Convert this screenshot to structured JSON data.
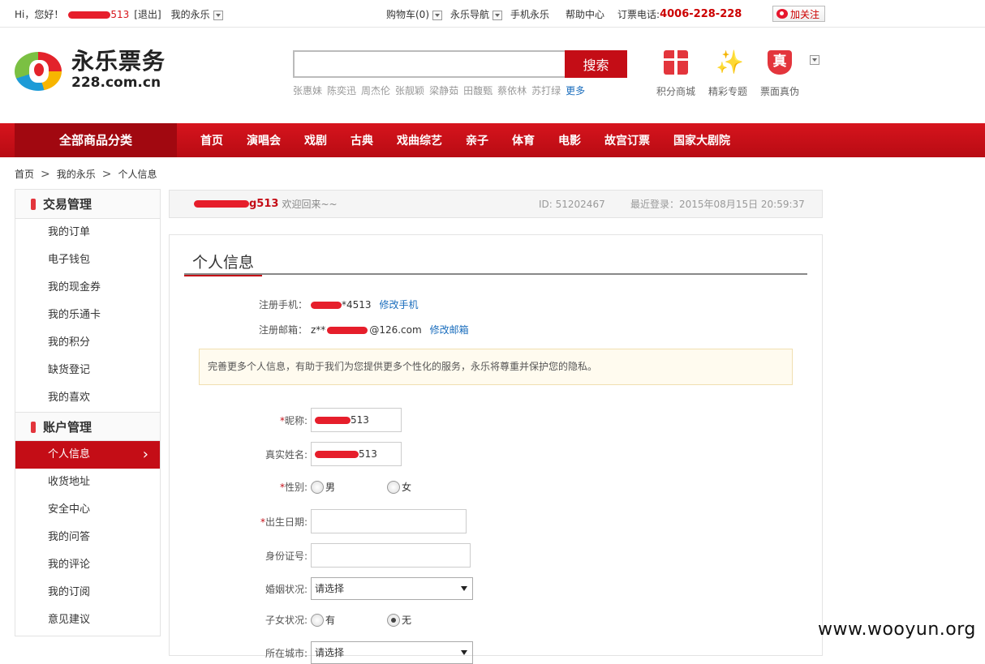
{
  "topbar": {
    "greeting": "Hi，您好！",
    "username_tail": "513",
    "logout": "[退出]",
    "my_yongle": "我的永乐",
    "cart": "购物车(0)",
    "nav_guide": "永乐导航",
    "mobile": "手机永乐",
    "help": "帮助中心",
    "phone_label": "订票电话:",
    "phone": "4006-228-228",
    "follow": "加关注"
  },
  "header": {
    "logo_cn": "永乐票务",
    "logo_en": "228.com.cn",
    "search_button": "搜索",
    "search_placeholder": "",
    "hot_keywords": [
      "张惠妹",
      "陈奕迅",
      "周杰伦",
      "张靓颖",
      "梁静茹",
      "田馥甄",
      "蔡依林",
      "苏打绿"
    ],
    "hot_more": "更多",
    "icons": [
      {
        "label": "积分商城",
        "icon": "gift-icon"
      },
      {
        "label": "精彩专题",
        "icon": "sparkle-wand-icon"
      },
      {
        "label": "票面真伪",
        "icon": "shield-true-icon",
        "glyph": "真"
      }
    ]
  },
  "nav": {
    "all_categories": "全部商品分类",
    "items": [
      "首页",
      "演唱会",
      "戏剧",
      "古典",
      "戏曲综艺",
      "亲子",
      "体育",
      "电影",
      "故宫订票",
      "国家大剧院"
    ]
  },
  "breadcrumb": [
    "首页",
    "我的永乐",
    "个人信息"
  ],
  "sidebar": {
    "section1_title": "交易管理",
    "section1_items": [
      "我的订单",
      "电子钱包",
      "我的现金券",
      "我的乐通卡",
      "我的积分",
      "缺货登记",
      "我的喜欢"
    ],
    "section2_title": "账户管理",
    "section2_items": [
      "个人信息",
      "收货地址",
      "安全中心",
      "我的问答",
      "我的评论",
      "我的订阅",
      "意见建议"
    ]
  },
  "welcome": {
    "name_tail": "g513",
    "message": "欢迎回来~~",
    "id_text": "ID:  51202467",
    "last_login": "最近登录：2015年08月15日 20:59:37"
  },
  "main": {
    "title": "个人信息",
    "phone_label": "注册手机：",
    "phone_value_tail": "*4513",
    "phone_link": "修改手机",
    "email_label": "注册邮箱：",
    "email_prefix": "z**",
    "email_suffix": "@126.com",
    "email_link": "修改邮箱",
    "notice": "完善更多个人信息，有助于我们为您提供更多个性化的服务，永乐将尊重并保护您的隐私。",
    "nickname_label": "昵称:",
    "nickname_tail": "513",
    "realname_label": "真实姓名:",
    "realname_tail": "513",
    "gender_label": "性别:",
    "gender_male": "男",
    "gender_female": "女",
    "birthday_label": "出生日期:",
    "idcard_label": "身份证号:",
    "marital_label": "婚姻状况:",
    "marital_value": "请选择",
    "children_label": "子女状况:",
    "children_yes": "有",
    "children_no": "无",
    "city_label": "所在城市:",
    "city_value": "请选择",
    "required_mark": "*"
  },
  "watermark": "www.wooyun.org",
  "colors": {
    "brand_red": "#c40d16",
    "link_blue": "#1a6dbd"
  }
}
